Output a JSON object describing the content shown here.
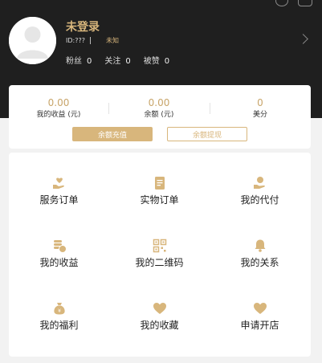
{
  "header": {
    "username": "未登录",
    "id_label": "ID:???",
    "gender": "未知",
    "stats": [
      {
        "label": "粉丝",
        "value": "0"
      },
      {
        "label": "关注",
        "value": "0"
      },
      {
        "label": "被赞",
        "value": "0"
      }
    ]
  },
  "wallet": {
    "items": [
      {
        "value": "0.00",
        "label": "我的收益 (元)"
      },
      {
        "value": "0.00",
        "label": "余额 (元)"
      },
      {
        "value": "0",
        "label": "美分"
      }
    ],
    "recharge_label": "余额充值",
    "withdraw_label": "余额提现"
  },
  "menu": {
    "items": [
      {
        "label": "服务订单",
        "icon": "hand-heart-icon"
      },
      {
        "label": "实物订单",
        "icon": "document-icon"
      },
      {
        "label": "我的代付",
        "icon": "hand-coin-icon"
      },
      {
        "label": "我的收益",
        "icon": "coin-stack-icon"
      },
      {
        "label": "我的二维码",
        "icon": "qr-code-icon"
      },
      {
        "label": "我的关系",
        "icon": "bell-icon"
      },
      {
        "label": "我的福利",
        "icon": "money-bag-icon"
      },
      {
        "label": "我的收藏",
        "icon": "heart-icon"
      },
      {
        "label": "申请开店",
        "icon": "heart-icon"
      }
    ]
  },
  "colors": {
    "accent": "#d8b67c",
    "header_bg": "#1f1f1f"
  }
}
